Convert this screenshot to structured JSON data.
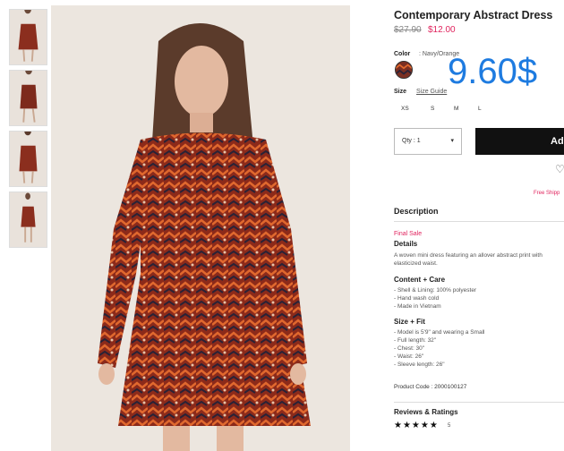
{
  "product": {
    "title": "Contemporary Abstract Dress",
    "price_original": "$27.90",
    "price_sale": "$12.00",
    "overlay_price": "9.60$",
    "color_label": "Color",
    "color_value": ": Navy/Orange",
    "size_label": "Size",
    "size_guide": "Size Guide",
    "sizes": [
      "XS",
      "S",
      "M",
      "L"
    ],
    "quantity": "Qty : 1",
    "add_button": "Add",
    "free_shipping": "Free Shipp",
    "description_heading": "Description",
    "final_sale": "Final Sale",
    "details_heading": "Details",
    "details_text": "A woven mini dress featuring an allover abstract print with elasticized waist.",
    "content_heading": "Content + Care",
    "content_items": [
      "- Shell & Lining: 100% polyester",
      "- Hand wash cold",
      "- Made in Vietnam"
    ],
    "size_fit_heading": "Size + Fit",
    "size_fit_items": [
      "- Model is 5'9\" and wearing a Small",
      "- Full length: 32\"",
      "- Chest: 30\"",
      "- Waist: 26\"",
      "- Sleeve length: 26\""
    ],
    "product_code": "Product Code : 2000100127",
    "reviews_heading": "Reviews & Ratings",
    "stars": "★★★★★",
    "review_count": "5"
  },
  "icons": {
    "caret": "dropdown-caret-icon",
    "heart": "heart-icon"
  },
  "colors": {
    "sale": "#e0245e",
    "overlay": "#1e7be0",
    "button": "#111111"
  }
}
